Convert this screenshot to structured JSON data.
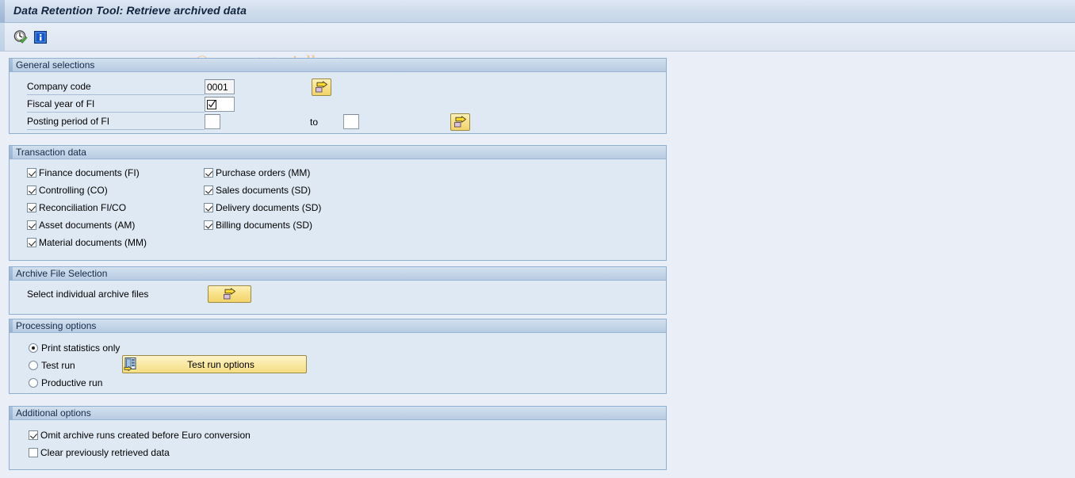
{
  "window": {
    "title": "Data Retention Tool: Retrieve archived data"
  },
  "toolbar": {
    "buttons": [
      {
        "name": "execute-clock-icon",
        "tooltip": "Execute"
      },
      {
        "name": "info-icon",
        "tooltip": "Information"
      }
    ]
  },
  "watermark": "© www.tutorialkart.com",
  "sections": {
    "general": {
      "title": "General selections",
      "fields": [
        {
          "label": "Company code",
          "value": "0001",
          "placeholder": ""
        },
        {
          "label": "Fiscal year of FI",
          "value": "",
          "placeholder": ""
        },
        {
          "label": "Posting period of FI",
          "value": "",
          "placeholder": ""
        }
      ],
      "to_label": "to",
      "to_value": "",
      "multi_select_icon": "multiple-selection-arrow-icon"
    },
    "transaction": {
      "title": "Transaction data",
      "left_column": [
        {
          "label": "Finance documents (FI)",
          "checked": true
        },
        {
          "label": "Controlling (CO)",
          "checked": true
        },
        {
          "label": "Reconciliation FI/CO",
          "checked": true
        },
        {
          "label": "Asset documents (AM)",
          "checked": true
        },
        {
          "label": "Material documents (MM)",
          "checked": true
        }
      ],
      "right_column": [
        {
          "label": "Purchase orders (MM)",
          "checked": true
        },
        {
          "label": "Sales documents (SD)",
          "checked": true
        },
        {
          "label": "Delivery documents (SD)",
          "checked": true
        },
        {
          "label": "Billing documents (SD)",
          "checked": true
        }
      ]
    },
    "archive": {
      "title": "Archive File Selection",
      "label": "Select  individual archive files",
      "button_icon": "multiple-selection-arrow-icon"
    },
    "processing": {
      "title": "Processing options",
      "options": [
        {
          "label": "Print statistics only",
          "selected": true
        },
        {
          "label": "Test run",
          "selected": false
        },
        {
          "label": "Productive run",
          "selected": false
        }
      ],
      "test_run_button": {
        "label": "Test run options",
        "icon": "list-settings-icon"
      }
    },
    "additional": {
      "title": "Additional options",
      "options": [
        {
          "label": "Omit archive runs created before Euro conversion",
          "checked": true
        },
        {
          "label": "Clear previously retrieved data",
          "checked": false
        }
      ]
    }
  },
  "colors": {
    "title_bar": "#c8d8ea",
    "panel_header": "#c3d5e8",
    "panel_body": "#dfe9f3",
    "page_background": "#eaeff7",
    "button_yellow": "#f9e9a4",
    "watermark": "#f0c08a",
    "border": "#8fafd0"
  }
}
